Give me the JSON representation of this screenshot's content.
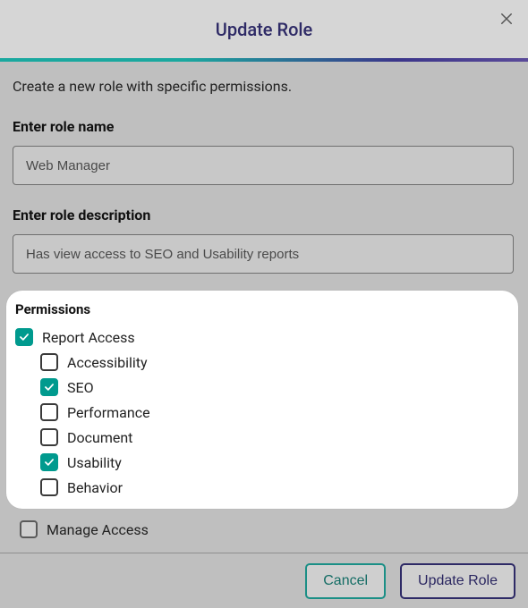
{
  "header": {
    "title": "Update Role"
  },
  "subtitle": "Create a new role with specific permissions.",
  "form": {
    "role_name_label": "Enter role name",
    "role_name_value": "Web Manager",
    "role_desc_label": "Enter role description",
    "role_desc_value": "Has view access to SEO and Usability reports"
  },
  "permissions": {
    "heading": "Permissions",
    "report_access": {
      "label": "Report Access",
      "checked": true
    },
    "children": [
      {
        "label": "Accessibility",
        "checked": false
      },
      {
        "label": "SEO",
        "checked": true
      },
      {
        "label": "Performance",
        "checked": false
      },
      {
        "label": "Document",
        "checked": false
      },
      {
        "label": "Usability",
        "checked": true
      },
      {
        "label": "Behavior",
        "checked": false
      }
    ],
    "manage_access": {
      "label": "Manage Access",
      "checked": false
    }
  },
  "footer": {
    "cancel_label": "Cancel",
    "submit_label": "Update Role"
  },
  "colors": {
    "accent_teal": "#009a8e",
    "accent_purple": "#2e2a66"
  }
}
